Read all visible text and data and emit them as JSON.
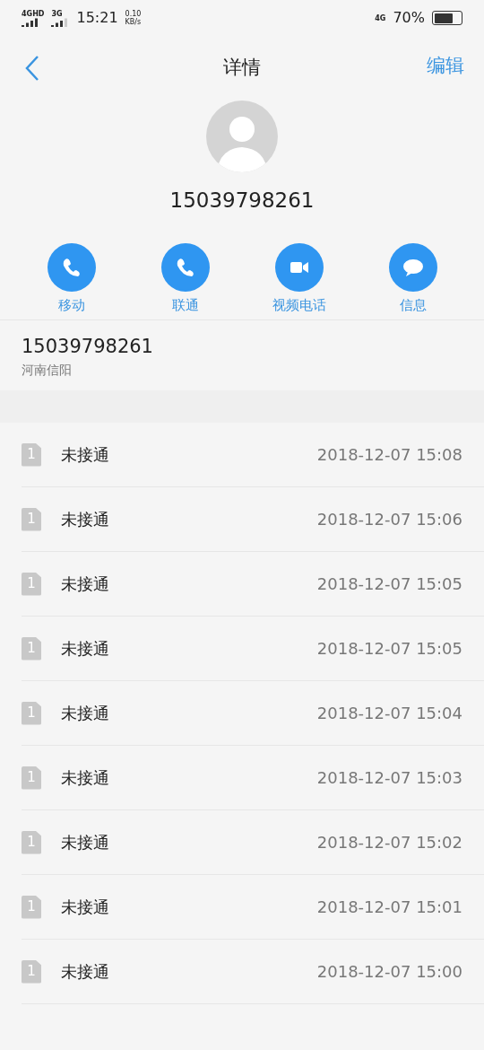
{
  "status_bar": {
    "network_1": "4G",
    "network_1_badge": "HD",
    "network_2": "3G",
    "time": "15:21",
    "speed": "0.10",
    "speed_unit": "KB/s",
    "network_3": "4G",
    "battery": "70%"
  },
  "header": {
    "title": "详情",
    "edit": "编辑"
  },
  "contact": {
    "number": "15039798261"
  },
  "actions": [
    {
      "kind": "phone",
      "label": "移动"
    },
    {
      "kind": "phone",
      "label": "联通"
    },
    {
      "kind": "video",
      "label": "视频电话"
    },
    {
      "kind": "message",
      "label": "信息"
    }
  ],
  "number_row": {
    "number": "15039798261",
    "location": "河南信阳"
  },
  "calls": [
    {
      "sim": "1",
      "status": "未接通",
      "time": "2018-12-07 15:08"
    },
    {
      "sim": "1",
      "status": "未接通",
      "time": "2018-12-07 15:06"
    },
    {
      "sim": "1",
      "status": "未接通",
      "time": "2018-12-07 15:05"
    },
    {
      "sim": "1",
      "status": "未接通",
      "time": "2018-12-07 15:05"
    },
    {
      "sim": "1",
      "status": "未接通",
      "time": "2018-12-07 15:04"
    },
    {
      "sim": "1",
      "status": "未接通",
      "time": "2018-12-07 15:03"
    },
    {
      "sim": "1",
      "status": "未接通",
      "time": "2018-12-07 15:02"
    },
    {
      "sim": "1",
      "status": "未接通",
      "time": "2018-12-07 15:01"
    },
    {
      "sim": "1",
      "status": "未接通",
      "time": "2018-12-07 15:00"
    }
  ]
}
